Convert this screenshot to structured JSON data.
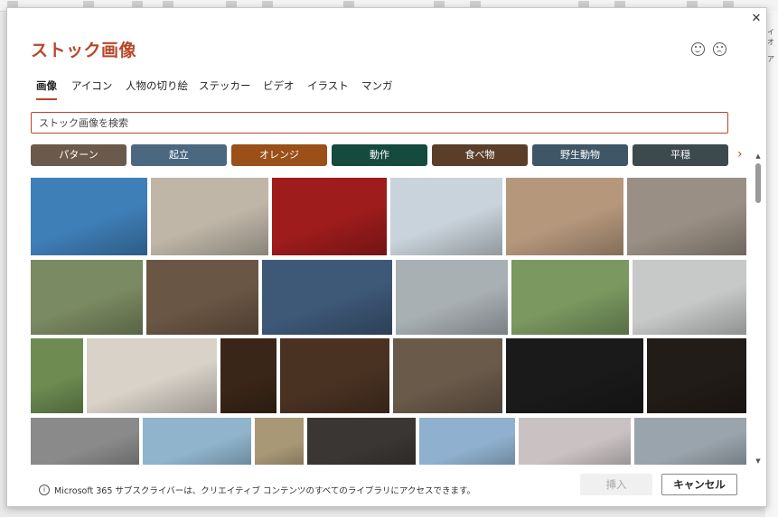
{
  "dialog": {
    "title": "ストック画像",
    "close_glyph": "✕",
    "feedback": [
      "smile-icon",
      "frown-icon"
    ]
  },
  "tabs": [
    {
      "label": "画像",
      "active": true
    },
    {
      "label": "アイコン",
      "active": false
    },
    {
      "label": "人物の切り絵",
      "active": false
    },
    {
      "label": "ステッカー",
      "active": false
    },
    {
      "label": "ビデオ",
      "active": false
    },
    {
      "label": "イラスト",
      "active": false
    },
    {
      "label": "マンガ",
      "active": false
    }
  ],
  "search": {
    "placeholder": "ストック画像を検索",
    "value": ""
  },
  "chips": [
    {
      "label": "パターン",
      "color": "#6b5a4c"
    },
    {
      "label": "起立",
      "color": "#4c6880"
    },
    {
      "label": "オレンジ",
      "color": "#9a5018"
    },
    {
      "label": "動作",
      "color": "#154a3e"
    },
    {
      "label": "食べ物",
      "color": "#5a3e2a"
    },
    {
      "label": "野生動物",
      "color": "#3e5666"
    },
    {
      "label": "平穏",
      "color": "#3c4a4e"
    }
  ],
  "chip_scroll_glyph": "›",
  "images": [
    {
      "name": "image-skyscraper",
      "color": "#3f7fb8"
    },
    {
      "name": "image-man-writing-desk",
      "color": "#bfb6a8"
    },
    {
      "name": "image-red-theater-seats",
      "color": "#9e1c1c"
    },
    {
      "name": "image-medical-team",
      "color": "#c9d3db"
    },
    {
      "name": "image-mother-kissing-child",
      "color": "#b5987c"
    },
    {
      "name": "image-wedding-couple-walking",
      "color": "#9a8f84"
    },
    {
      "name": "image-woman-drinking-tea",
      "color": "#7a8a62"
    },
    {
      "name": "image-pastry-closeup",
      "color": "#6a5644"
    },
    {
      "name": "image-icy-lake-dusk",
      "color": "#3e5878"
    },
    {
      "name": "image-yoga-mat",
      "color": "#a9b0b4"
    },
    {
      "name": "image-autumn-trees-lake",
      "color": "#7a9860"
    },
    {
      "name": "image-man-in-kitchen",
      "color": "#c7c9c8"
    },
    {
      "name": "image-cow-field",
      "color": "#6e8c52"
    },
    {
      "name": "image-woman-lying-bed",
      "color": "#d8d2c8"
    },
    {
      "name": "image-rocket-launch",
      "color": "#3a2618"
    },
    {
      "name": "image-lens-ball-bokeh",
      "color": "#4a3222"
    },
    {
      "name": "image-baguettes",
      "color": "#6a5a4a"
    },
    {
      "name": "image-tiara",
      "color": "#1a1a1a"
    },
    {
      "name": "image-ballet-stage",
      "color": "#221c18"
    },
    {
      "name": "image-spiral-staircase",
      "color": "#8a8a8a"
    },
    {
      "name": "image-beach-walk",
      "color": "#8fb4cc"
    },
    {
      "name": "image-hillside-village",
      "color": "#a89876"
    },
    {
      "name": "image-barber",
      "color": "#3a3634"
    },
    {
      "name": "image-statue-sky",
      "color": "#8fb1cf"
    },
    {
      "name": "image-piano-keys",
      "color": "#c9c1c2"
    },
    {
      "name": "image-businesswoman-city",
      "color": "#9aa4ac"
    }
  ],
  "footer": {
    "info_glyph": "i",
    "info_text": "Microsoft 365 サブスクライバーは、クリエイティブ コンテンツのすべてのライブラリにアクセスできます。",
    "insert_label": "挿入",
    "cancel_label": "キャンセル"
  },
  "background_app": {
    "right_labels": [
      "イオ",
      "ア"
    ]
  }
}
